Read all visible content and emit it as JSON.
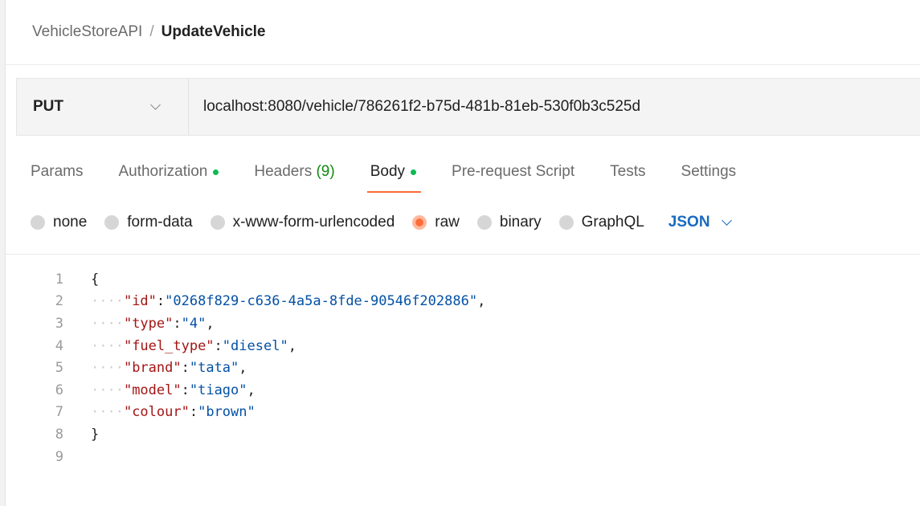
{
  "breadcrumb": {
    "parent": "VehicleStoreAPI",
    "separator": "/",
    "current": "UpdateVehicle"
  },
  "request": {
    "method": "PUT",
    "url": "localhost:8080/vehicle/786261f2-b75d-481b-81eb-530f0b3c525d"
  },
  "tabs": [
    {
      "label": "Params"
    },
    {
      "label": "Authorization",
      "indicator": "green-dot"
    },
    {
      "label": "Headers",
      "count": "(9)"
    },
    {
      "label": "Body",
      "indicator": "green-dot",
      "active": true
    },
    {
      "label": "Pre-request Script"
    },
    {
      "label": "Tests"
    },
    {
      "label": "Settings"
    }
  ],
  "body_types": {
    "options": [
      "none",
      "form-data",
      "x-www-form-urlencoded",
      "raw",
      "binary",
      "GraphQL"
    ],
    "selected": "raw",
    "language": "JSON"
  },
  "editor": {
    "line_numbers": [
      "1",
      "2",
      "3",
      "4",
      "5",
      "6",
      "7",
      "8",
      "9"
    ],
    "open_brace": "{",
    "close_brace": "}",
    "entries": [
      {
        "key": "\"id\"",
        "value": "\"0268f829-c636-4a5a-8fde-90546f202886\"",
        "comma": ","
      },
      {
        "key": "\"type\"",
        "value": "\"4\"",
        "comma": ","
      },
      {
        "key": "\"fuel_type\"",
        "value": "\"diesel\"",
        "comma": ","
      },
      {
        "key": "\"brand\"",
        "value": "\"tata\"",
        "comma": ","
      },
      {
        "key": "\"model\"",
        "value": "\"tiago\"",
        "comma": ","
      },
      {
        "key": "\"colour\"",
        "value": "\"brown\"",
        "comma": ""
      }
    ]
  },
  "colors": {
    "accent": "#ff6c37",
    "active_indicator": "#0cbb52",
    "json_link": "#1a6ac1",
    "json_key": "#a31515",
    "json_string": "#0451a5"
  }
}
